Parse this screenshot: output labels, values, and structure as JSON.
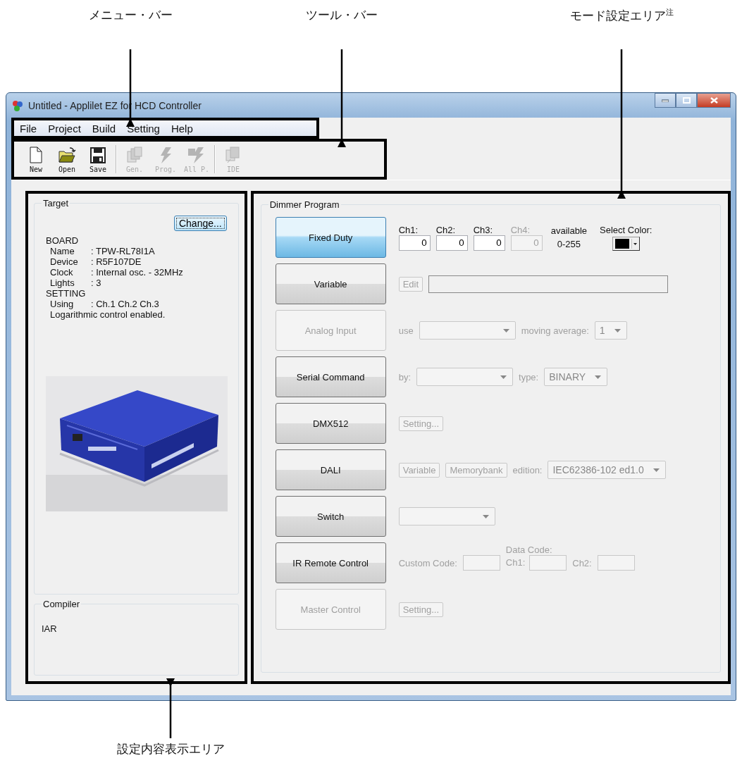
{
  "annotations": [
    {
      "text": "メニュー・バー"
    },
    {
      "text": "ツール・バー"
    },
    {
      "text": "モード設定エリア$^{注}$"
    },
    {
      "text": "設定内容表示エリア"
    }
  ],
  "window": {
    "title": "Untitled - Applilet EZ for HCD Controller"
  },
  "menu": [
    "File",
    "Project",
    "Build",
    "Setting",
    "Help"
  ],
  "toolbar": [
    [
      {
        "label": "New",
        "disabled": false
      },
      {
        "label": "Open",
        "disabled": false
      },
      {
        "label": "Save",
        "disabled": false
      }
    ],
    [
      {
        "label": "Gen.",
        "disabled": true
      },
      {
        "label": "Prog.",
        "disabled": true
      },
      {
        "label": "All P.",
        "disabled": true
      }
    ],
    [
      {
        "label": "IDE",
        "disabled": true
      }
    ]
  ],
  "target": {
    "title": "Target",
    "button": "Change...",
    "sections": [
      {
        "heading": "BOARD",
        "rows": [
          {
            "label": "Name",
            "value": ": TPW-RL78I1A"
          },
          {
            "label": "Device",
            "value": ": R5F107DE"
          },
          {
            "label": "Clock",
            "value": ": Internal osc. - 32MHz"
          },
          {
            "label": "Lights",
            "value": ": 3"
          }
        ]
      },
      {
        "heading": "SETTING",
        "rows": [
          {
            "label": "Using",
            "value": ": Ch.1 Ch.2 Ch.3"
          },
          {
            "label": "Logarithmic control enabled."
          }
        ]
      }
    ]
  },
  "compiler": {
    "title": "Compiler",
    "value": "IAR"
  },
  "dimmer": {
    "title": "Dimmer Program",
    "modes": [
      {
        "label": "Fixed Duty",
        "selected": true,
        "disabled": false,
        "controls": [
          {
            "kind": "channel",
            "label": "Ch1:",
            "value": "0",
            "disabled": false
          },
          {
            "kind": "channel",
            "label": "Ch2:",
            "value": "0",
            "disabled": false
          },
          {
            "kind": "channel",
            "label": "Ch3:",
            "value": "0",
            "disabled": false
          },
          {
            "kind": "channel",
            "label": "Ch4:",
            "value": "0",
            "disabled": true
          },
          {
            "kind": "range",
            "label": "available",
            "value": "0-255"
          },
          {
            "kind": "color",
            "label": "Select Color:",
            "color": "#000000"
          }
        ]
      },
      {
        "label": "Variable",
        "selected": false,
        "disabled": false,
        "controls": [
          {
            "kind": "button",
            "label": "Edit",
            "disabled": true
          },
          {
            "kind": "path-field",
            "disabled": true
          }
        ]
      },
      {
        "label": "Analog Input",
        "selected": false,
        "disabled": true,
        "controls": [
          {
            "kind": "text",
            "label": "use",
            "disabled": true
          },
          {
            "kind": "dropdown",
            "disabled": true
          },
          {
            "kind": "text",
            "label": "moving average:",
            "disabled": true
          },
          {
            "kind": "dropdown",
            "value": "1",
            "disabled": true
          }
        ]
      },
      {
        "label": "Serial Command",
        "selected": false,
        "disabled": false,
        "controls": [
          {
            "kind": "text",
            "label": "by:",
            "disabled": true
          },
          {
            "kind": "dropdown",
            "disabled": true
          },
          {
            "kind": "text",
            "label": "type:",
            "disabled": true
          },
          {
            "kind": "dropdown",
            "value": "BINARY",
            "disabled": true
          }
        ]
      },
      {
        "label": "DMX512",
        "selected": false,
        "disabled": false,
        "controls": [
          {
            "kind": "button",
            "label": "Setting...",
            "disabled": true
          }
        ]
      },
      {
        "label": "DALI",
        "selected": false,
        "disabled": false,
        "controls": [
          {
            "kind": "button",
            "label": "Variable",
            "disabled": true
          },
          {
            "kind": "button",
            "label": "Memorybank",
            "disabled": true
          },
          {
            "kind": "text",
            "label": "edition:",
            "disabled": true
          },
          {
            "kind": "dropdown",
            "value": "IEC62386-102 ed1.0",
            "disabled": true
          }
        ]
      },
      {
        "label": "Switch",
        "selected": false,
        "disabled": false,
        "controls": [
          {
            "kind": "dropdown",
            "disabled": true
          }
        ]
      },
      {
        "label": "IR Remote Control",
        "selected": false,
        "disabled": false,
        "controls": [
          {
            "kind": "text",
            "label": "Custom Code:",
            "disabled": true
          },
          {
            "kind": "field",
            "disabled": true
          },
          {
            "kind": "group",
            "caption": "Data Code:",
            "disabled": true,
            "controls": [
              {
                "kind": "text",
                "label": "Ch1:",
                "disabled": true
              },
              {
                "kind": "field",
                "disabled": true
              }
            ]
          },
          {
            "kind": "text",
            "label": "Ch2:",
            "disabled": true
          },
          {
            "kind": "field",
            "disabled": true
          }
        ]
      },
      {
        "label": "Master Control",
        "selected": false,
        "disabled": true,
        "controls": [
          {
            "kind": "button",
            "label": "Setting...",
            "disabled": true
          }
        ]
      }
    ]
  }
}
